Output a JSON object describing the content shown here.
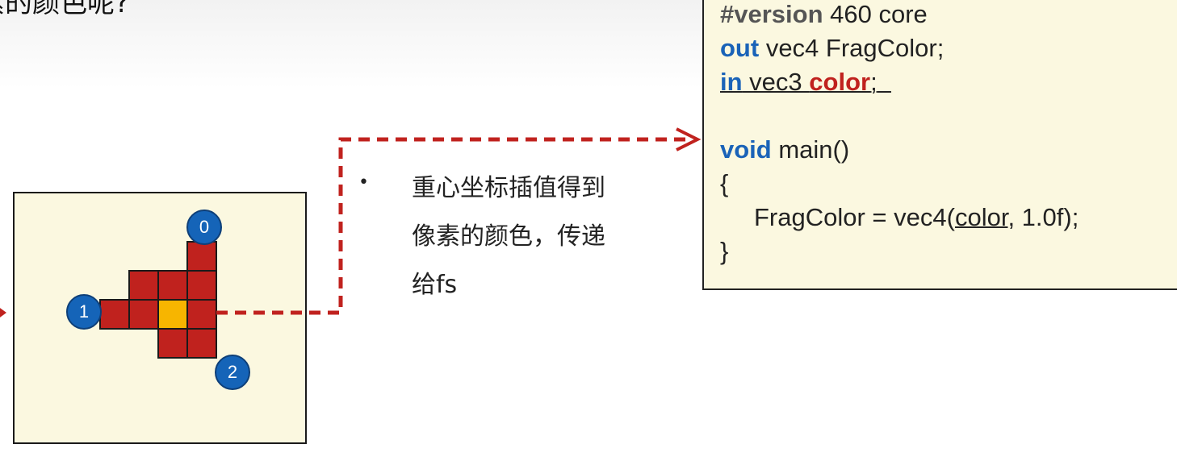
{
  "slide": {
    "title_fragment": "素的颜色呢?"
  },
  "raster": {
    "vertex_labels": [
      "0",
      "1",
      "2"
    ],
    "colors": {
      "panel": "#fbf8e0",
      "pixel": "#c0221e",
      "pixel_border": "#1a1a1a",
      "highlight_pixel": "#f7b500",
      "vertex": "#1564b8",
      "connector": "#c0221e"
    }
  },
  "bullet": {
    "marker": "•",
    "text": "重心坐标插值得到\n像素的颜色，传递\n给fs"
  },
  "shader_code": {
    "line1": {
      "keyword": "#version",
      "rest": " 460 core"
    },
    "line2": {
      "keyword": "out",
      "rest": " vec4 FragColor;"
    },
    "line3": {
      "keyword": "in",
      "middle": " vec3 ",
      "variable": "color",
      "end": ";"
    },
    "line4": {
      "keyword": "void",
      "rest": " main()"
    },
    "line5": "{",
    "line6": {
      "before": "FragColor = vec4(",
      "variable": "color",
      "after": ", 1.0f);"
    },
    "line7": "}",
    "colors": {
      "keyword": "#1a63b8",
      "variable": "#c0221e",
      "preprocessor": "#555555"
    }
  }
}
